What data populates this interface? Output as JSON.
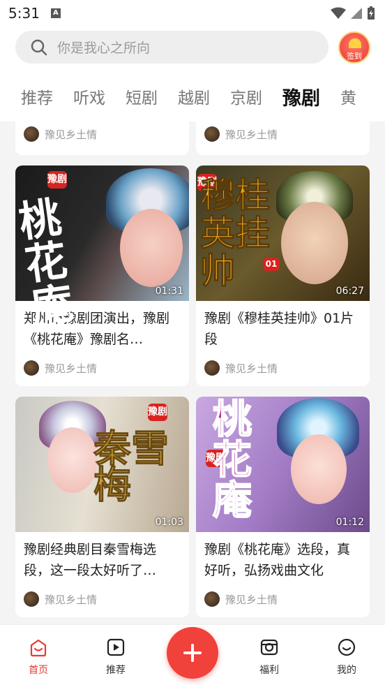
{
  "status_bar": {
    "time": "5:31",
    "a_icon": "A"
  },
  "search": {
    "placeholder": "你是我心之所向"
  },
  "signin": {
    "label": "签到"
  },
  "tabs": [
    "推荐",
    "听戏",
    "短剧",
    "越剧",
    "京剧",
    "豫剧",
    "黄"
  ],
  "active_tab": "豫剧",
  "top_row": [
    {
      "author": "豫见乡土情"
    },
    {
      "author": "豫见乡土情"
    }
  ],
  "videos": [
    {
      "badge": "豫剧",
      "overlay": "桃花庵",
      "duration": "01:31",
      "title": "郑州市豫剧团演出，豫剧《桃花庵》豫剧名…",
      "author": "豫见乡土情"
    },
    {
      "badge": "豫剧",
      "overlay": "穆桂英挂帅",
      "episode": "01",
      "duration": "06:27",
      "title": "豫剧《穆桂英挂帅》01片段",
      "author": "豫见乡土情"
    },
    {
      "badge": "豫剧",
      "overlay": "秦雪梅",
      "duration": "01:03",
      "title": "豫剧经典剧目秦雪梅选段，这一段太好听了…",
      "author": "豫见乡土情"
    },
    {
      "badge": "豫剧",
      "overlay": "桃花庵",
      "duration": "01:12",
      "title": "豫剧《桃花庵》选段，真好听，弘扬戏曲文化",
      "author": "豫见乡土情"
    }
  ],
  "bottom_nav": {
    "home": "首页",
    "recommend": "推荐",
    "welfare": "福利",
    "mine": "我的"
  },
  "colors": {
    "accent": "#e8392f",
    "background": "#f4f4f4"
  }
}
